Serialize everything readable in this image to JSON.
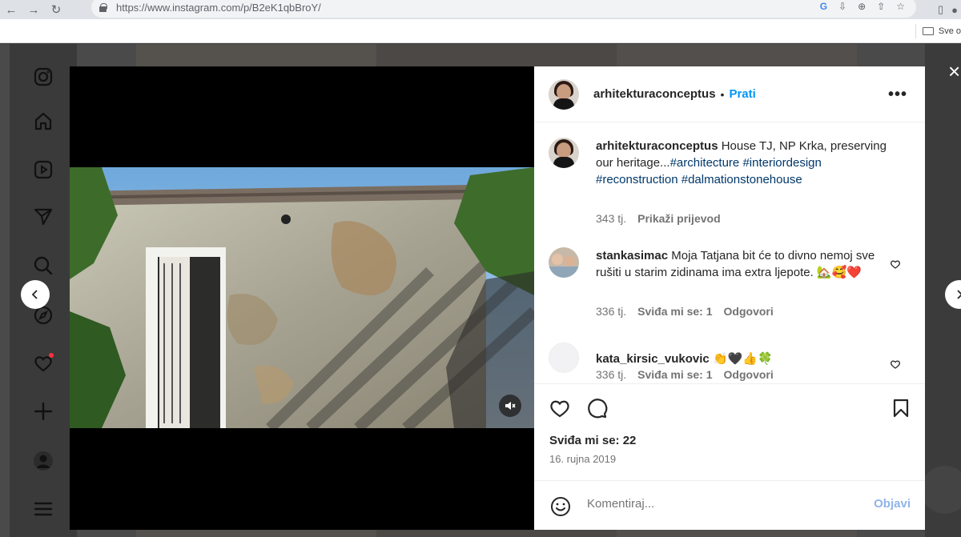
{
  "browser": {
    "url": "https://www.instagram.com/p/B2eK1qbBroY/",
    "bookmarks_folder": "Sve o"
  },
  "post": {
    "username": "arhitekturaconceptus",
    "separator": "•",
    "follow_label": "Prati",
    "more_label": "•••",
    "caption": {
      "username": "arhitekturaconceptus",
      "text": "House TJ, NP Krka, preserving our heritage...",
      "tags": [
        "#architecture",
        "#interiordesign",
        "#reconstruction",
        "#dalmationstonehouse"
      ],
      "age": "343 tj.",
      "translate_label": "Prikaži prijevod"
    },
    "comments": [
      {
        "username": "stankasimac",
        "text": "Moja Tatjana bit će to divno nemoj sve rušiti u starim zidinama ima extra ljepote. 🏡🥰❤️",
        "age": "336 tj.",
        "likes": "Sviđa mi se: 1",
        "reply": "Odgovori"
      },
      {
        "username": "kata_kirsic_vukovic",
        "text": "👏🖤👍🍀",
        "age": "336 tj.",
        "likes": "Sviđa mi se: 1",
        "reply": "Odgovori"
      }
    ],
    "likes_count": "Sviđa mi se: 22",
    "date": "16. rujna 2019",
    "comment_placeholder": "Komentiraj...",
    "post_button": "Objavi"
  },
  "colors": {
    "link": "#0095f6",
    "hashtag": "#00376b",
    "muted": "#737373",
    "post_button_disabled": "#8fb4e8"
  }
}
